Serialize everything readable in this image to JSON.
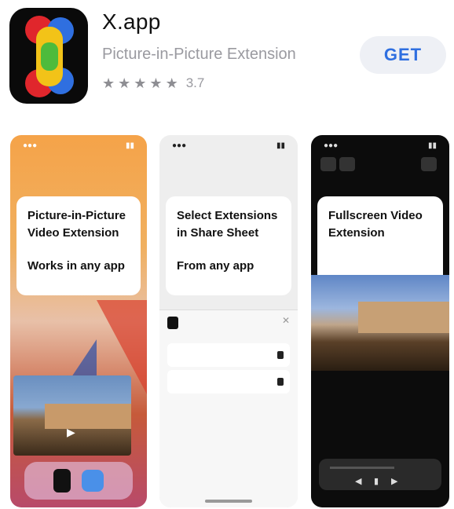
{
  "app": {
    "title": "X.app",
    "subtitle": "Picture-in-Picture Extension",
    "rating_value": "3.7",
    "stars": [
      "★",
      "★",
      "★",
      "★",
      "★"
    ],
    "get_label": "GET"
  },
  "screenshots": [
    {
      "caption_line1": "Picture-in-Picture",
      "caption_line2": "Video Extension",
      "caption_line3": "Works in any app"
    },
    {
      "caption_line1": "Select Extensions",
      "caption_line2": "in Share Sheet",
      "caption_line3": "From any app"
    },
    {
      "caption_line1": "Fullscreen Video",
      "caption_line2": "Extension"
    }
  ],
  "colors": {
    "accent": "#2f6fe0",
    "button_bg": "#eef0f5"
  },
  "icons": [
    "app-icon",
    "star-icon",
    "play-icon"
  ]
}
